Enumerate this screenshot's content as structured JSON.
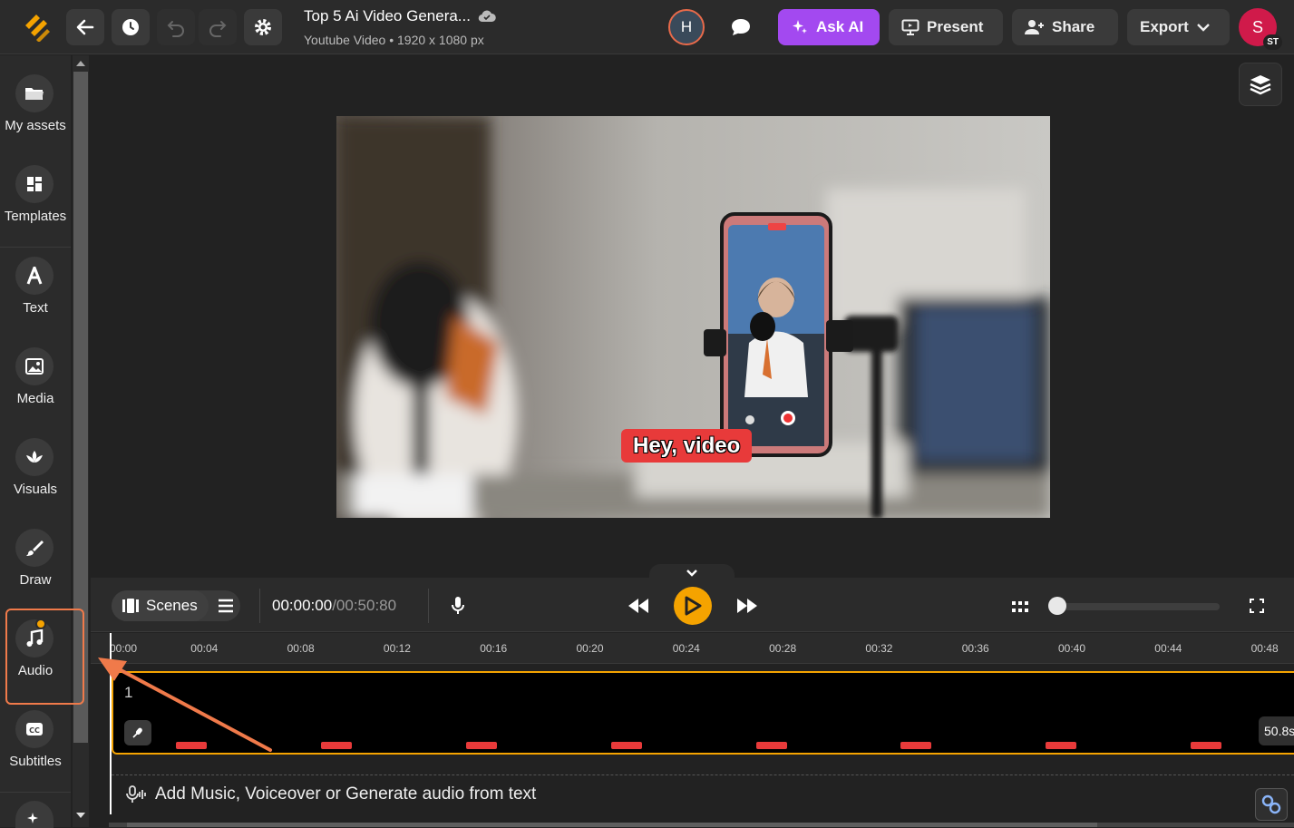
{
  "topbar": {
    "project_title": "Top 5 Ai Video Genera...",
    "project_subtitle": "Youtube Video • 1920 x 1080 px",
    "collaborator_initial": "H",
    "ask_ai_label": "Ask AI",
    "present_label": "Present",
    "share_label": "Share",
    "export_label": "Export",
    "user_initial": "S",
    "user_badge": "ST"
  },
  "sidebar": {
    "items": [
      {
        "label": "My assets",
        "icon": "folder-icon"
      },
      {
        "label": "Templates",
        "icon": "templates-icon"
      },
      {
        "label": "Text",
        "icon": "text-icon"
      },
      {
        "label": "Media",
        "icon": "image-icon"
      },
      {
        "label": "Visuals",
        "icon": "visuals-icon"
      },
      {
        "label": "Draw",
        "icon": "brush-icon"
      },
      {
        "label": "Audio",
        "icon": "music-note-icon"
      },
      {
        "label": "Subtitles",
        "icon": "cc-icon"
      }
    ]
  },
  "canvas": {
    "caption_text": "Hey, video"
  },
  "controls": {
    "scenes_label": "Scenes",
    "current_time": "00:00:00",
    "total_time": "/00:50:80",
    "zoom_level": 0
  },
  "timeline": {
    "ticks": [
      "00:00",
      "00:04",
      "00:08",
      "00:12",
      "00:16",
      "00:20",
      "00:24",
      "00:28",
      "00:32",
      "00:36",
      "00:40",
      "00:44",
      "00:48"
    ],
    "scene_number": "1",
    "duration_label": "50.8s",
    "audio_prompt": "Add Music, Voiceover or Generate audio from text"
  },
  "colors": {
    "accent": "#f5a300",
    "ai_button": "#a349f0",
    "highlight": "#f07a4a",
    "caption_bg": "#e83a3a"
  }
}
